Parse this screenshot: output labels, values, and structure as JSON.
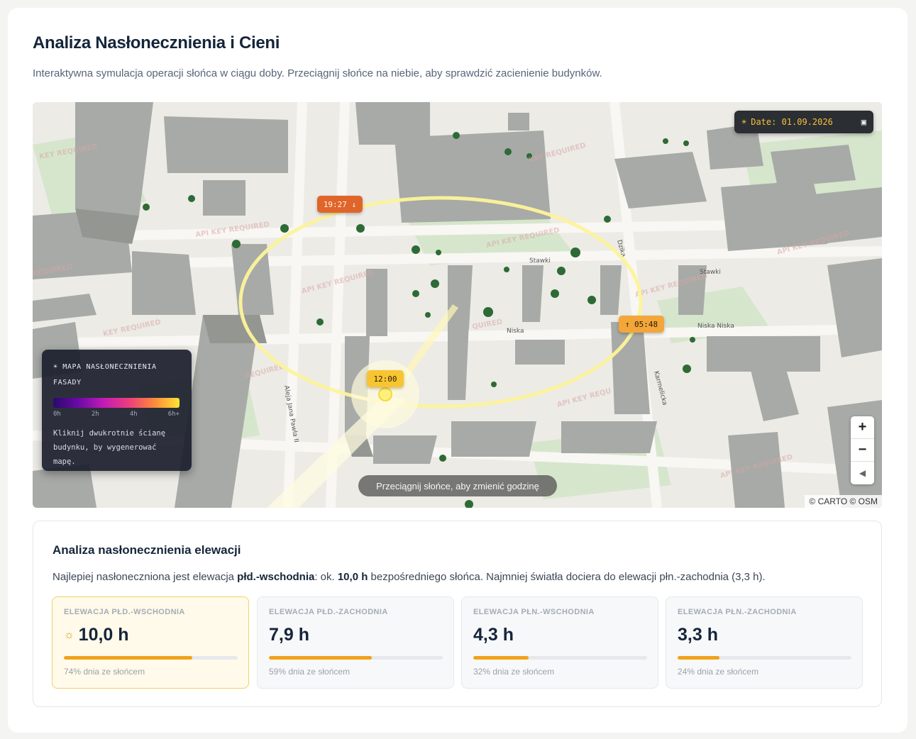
{
  "header": {
    "title": "Analiza Nasłonecznienia i Cieni",
    "subtitle": "Interaktywna symulacja operacji słońca w ciągu doby. Przeciągnij słońce na niebie, aby sprawdzić zacienienie budynków."
  },
  "map": {
    "date_label": "Date: 01.09.2026",
    "date_icon": "sun-icon",
    "calendar_icon": "calendar-icon",
    "sunset_time": "19:27 ↓",
    "sunrise_time": "↑ 05:48",
    "noon_time": "12:00",
    "drag_hint": "Przeciągnij słońce, aby zmienić godzinę",
    "zoom_in": "+",
    "zoom_out": "−",
    "reset_north": "◀",
    "attribution": "© CARTO © OSM",
    "watermark": "API KEY REQUIRED",
    "street_labels": [
      "Stawki",
      "Niska",
      "Niska Niska",
      "Karmelicka",
      "Aleja Jana Pawła II",
      "Dzika"
    ],
    "legend": {
      "title_line1": "☀ MAPA NASŁONECZNIENIA",
      "title_line2": "FASADY",
      "ticks": [
        "0h",
        "2h",
        "4h",
        "6h+"
      ],
      "note_line1": "Kliknij dwukrotnie ścianę",
      "note_line2": "budynku, by wygenerować mapę."
    }
  },
  "analysis": {
    "title": "Analiza nasłonecznienia elewacji",
    "summary_pre": "Najlepiej nasłoneczniona jest elewacja ",
    "summary_best": "płd.-wschodnia",
    "summary_mid": ": ok. ",
    "summary_value": "10,0 h",
    "summary_post": " bezpośredniego słońca. Najmniej światła dociera do elewacji płn.-zachodnia (3,3 h).",
    "tiles": [
      {
        "label": "ELEWACJA PŁD.-WSCHODNIA",
        "value": "10,0 h",
        "percent_text": "74% dnia ze słońcem",
        "fraction": 0.74,
        "best": true
      },
      {
        "label": "ELEWACJA PŁD.-ZACHODNIA",
        "value": "7,9 h",
        "percent_text": "59% dnia ze słońcem",
        "fraction": 0.59,
        "best": false
      },
      {
        "label": "ELEWACJA PŁN.-WSCHODNIA",
        "value": "4,3 h",
        "percent_text": "32% dnia ze słońcem",
        "fraction": 0.32,
        "best": false
      },
      {
        "label": "ELEWACJA PŁN.-ZACHODNIA",
        "value": "3,3 h",
        "percent_text": "24% dnia ze słońcem",
        "fraction": 0.24,
        "best": false
      }
    ],
    "colors": {
      "accent": "#f1a21a",
      "best_bg": "#fffaea",
      "best_border": "#f1d068"
    }
  }
}
